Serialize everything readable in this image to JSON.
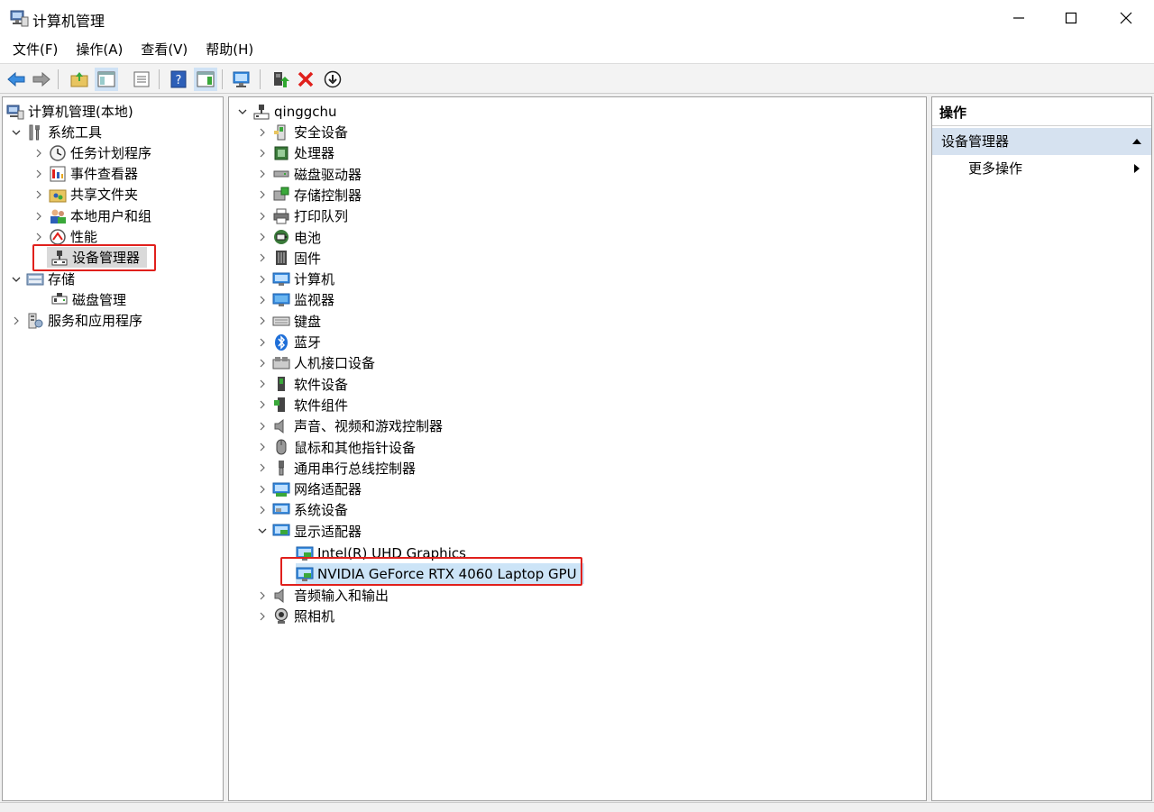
{
  "window": {
    "title": "计算机管理",
    "icon": "computer-management-icon"
  },
  "menu": [
    "文件(F)",
    "操作(A)",
    "查看(V)",
    "帮助(H)"
  ],
  "left_tree": {
    "root": "计算机管理(本地)",
    "system_tools": "系统工具",
    "task_scheduler": "任务计划程序",
    "event_viewer": "事件查看器",
    "shared_folders": "共享文件夹",
    "local_users": "本地用户和组",
    "performance": "性能",
    "device_manager": "设备管理器",
    "storage": "存储",
    "disk_management": "磁盘管理",
    "services": "服务和应用程序"
  },
  "device_tree": {
    "computer_name": "qinggchu",
    "categories": [
      "安全设备",
      "处理器",
      "磁盘驱动器",
      "存储控制器",
      "打印队列",
      "电池",
      "固件",
      "计算机",
      "监视器",
      "键盘",
      "蓝牙",
      "人机接口设备",
      "软件设备",
      "软件组件",
      "声音、视频和游戏控制器",
      "鼠标和其他指针设备",
      "通用串行总线控制器",
      "网络适配器",
      "系统设备",
      "显示适配器"
    ],
    "display_adapters": [
      "Intel(R) UHD Graphics",
      "NVIDIA GeForce RTX 4060 Laptop GPU"
    ],
    "after": [
      "音频输入和输出",
      "照相机"
    ]
  },
  "actions": {
    "header": "操作",
    "section": "设备管理器",
    "more": "更多操作"
  },
  "colors": {
    "highlight": "#e0201c",
    "actions_section_bg": "#d6e2f0"
  }
}
